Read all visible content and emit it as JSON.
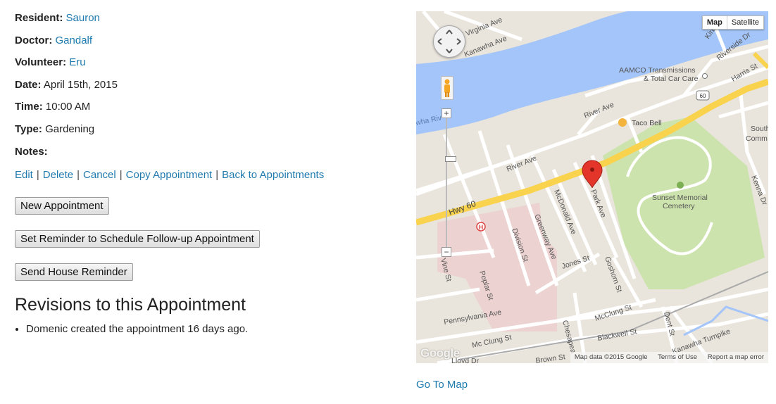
{
  "details": {
    "resident_label": "Resident:",
    "resident": "Sauron",
    "doctor_label": "Doctor:",
    "doctor": "Gandalf",
    "volunteer_label": "Volunteer:",
    "volunteer": "Eru",
    "date_label": "Date:",
    "date": "April 15th, 2015",
    "time_label": "Time:",
    "time": "10:00 AM",
    "type_label": "Type:",
    "type": "Gardening",
    "notes_label": "Notes:"
  },
  "actions": {
    "edit": "Edit",
    "delete": "Delete",
    "cancel": "Cancel",
    "copy": "Copy Appointment",
    "back": "Back to Appointments",
    "separator": "|"
  },
  "buttons": {
    "new_appointment": "New Appointment",
    "set_reminder": "Set Reminder to Schedule Follow-up Appointment",
    "send_house_reminder": "Send House Reminder"
  },
  "revisions": {
    "heading": "Revisions to this Appointment",
    "items": [
      "Domenic created the appointment 16 days ago."
    ]
  },
  "map": {
    "type_map": "Map",
    "type_satellite": "Satellite",
    "zoom_in": "+",
    "zoom_out": "−",
    "logo": "Google",
    "attribution": "Map data ©2015 Google",
    "terms": "Terms of Use",
    "report": "Report a map error",
    "labels": {
      "w_virginia": "W Virginia Ave",
      "kanawha_ave": "Kanawha Ave",
      "kirby": "Kirby St",
      "riverside": "Riverside Dr",
      "harris": "Harris St",
      "aamco_1": "AAMCO Transmissions",
      "aamco_2": "& Total Car Care",
      "river_ave_1": "River Ave",
      "river_ave_2": "River Ave",
      "taco": "Taco Bell",
      "south_1": "South",
      "south_2": "Comm",
      "hwy60_shield": "60",
      "hwy60": "Hwy 60",
      "park": "Park Ave",
      "sunset_1": "Sunset Memorial",
      "sunset_2": "Cemetery",
      "kenna": "Kenna Dr",
      "mcdonald": "McDonald Ave",
      "greenway": "Greenway Ave",
      "division": "Division St",
      "jones": "Jones St",
      "goshorn": "Goshorn St",
      "vine": "Vine St",
      "poplar": "Poplar St",
      "pennsylvania": "Pennsylvania Ave",
      "mcclung1": "McClung St",
      "mcclung2": "Mc Clung St",
      "chesapeake": "Chesapea",
      "blackwell": "Blackwell St",
      "dent": "Dent St",
      "kanawha_tpk": "Kanawha Turnpike",
      "lloyd": "Lloyd Dr",
      "brown": "Brown St",
      "hospital": "H",
      "riv": "wha Riv"
    },
    "colors": {
      "water": "#a4c5f9",
      "park": "#cde3ad",
      "hospital": "#ecd2d0",
      "highway": "#f9d24e",
      "pin": "#e3352a"
    }
  },
  "footer": {
    "go_to_map": "Go To Map"
  }
}
